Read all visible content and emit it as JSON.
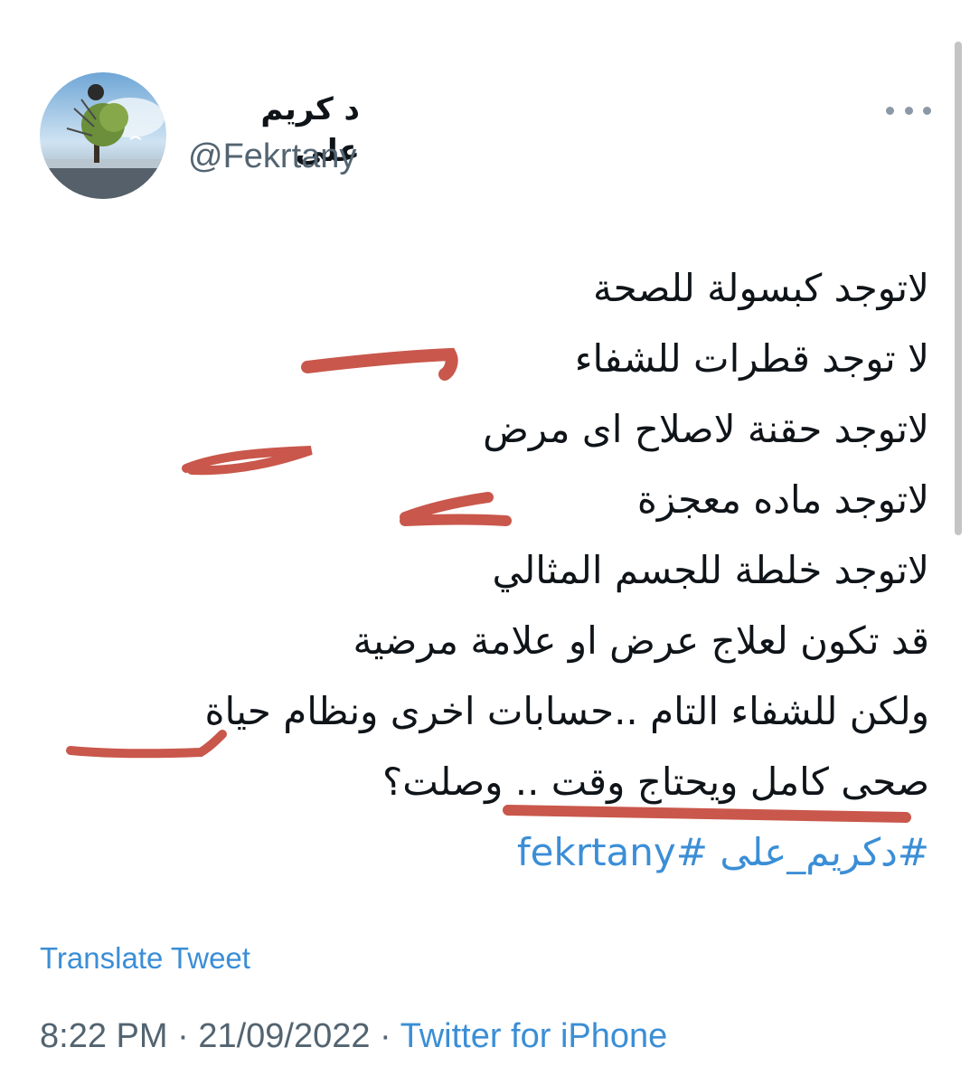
{
  "user": {
    "display_name": "د كريم على",
    "handle": "@Fekrtany",
    "avatar_icon": "avatar-landscape-tree-image"
  },
  "tweet": {
    "lines": [
      "لاتوجد كبسولة للصحة",
      "لا توجد قطرات للشفاء",
      "لاتوجد حقنة لاصلاح اى مرض",
      "لاتوجد ماده معجزة",
      "لاتوجد خلطة للجسم المثالي",
      "قد تكون لعلاج عرض او علامة مرضية",
      "ولكن للشفاء التام ..حسابات اخرى ونظام حياة",
      "صحى كامل ويحتاج وقت .. وصلت؟"
    ],
    "hashtags": "#دكريم_على #fekrtany"
  },
  "translate_label": "Translate Tweet",
  "meta": {
    "time": "8:22 PM",
    "separator": " · ",
    "date": "21/09/2022",
    "source": "Twitter for iPhone"
  },
  "colors": {
    "link": "#3b8ed6",
    "secondary_text": "#536471",
    "annotation_marker": "#c0392b"
  }
}
